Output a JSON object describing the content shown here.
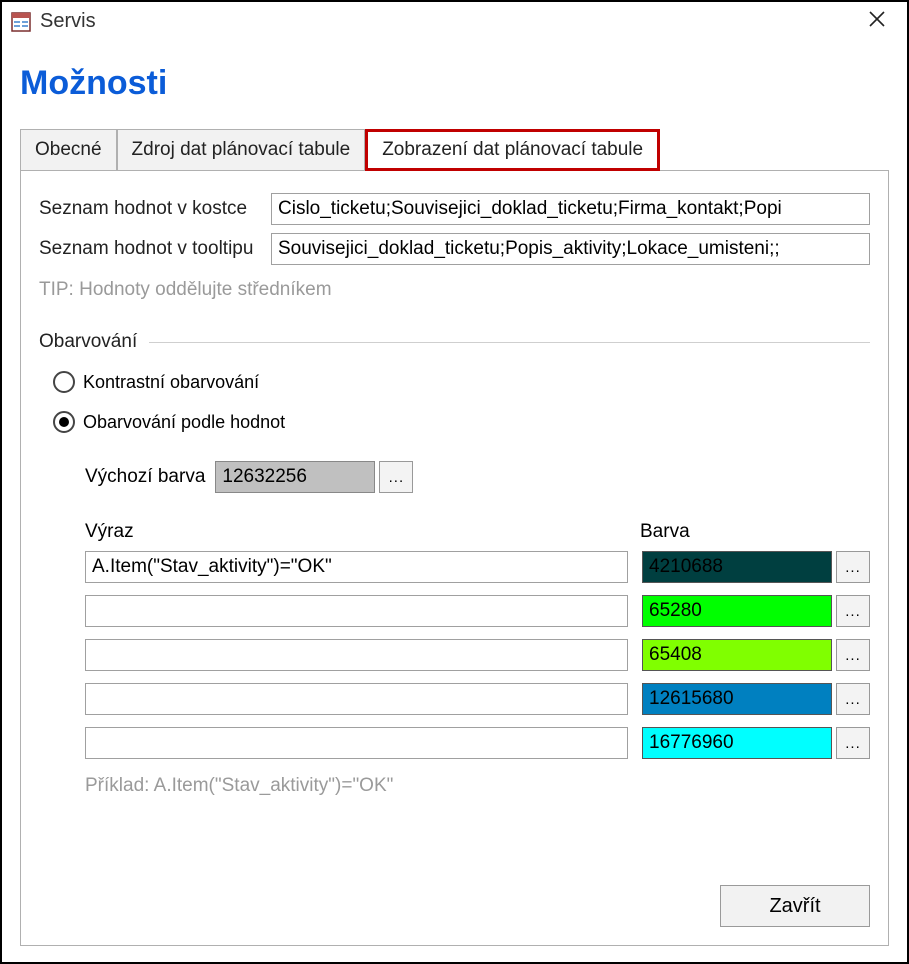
{
  "titlebar": {
    "title": "Servis"
  },
  "page_title": "Možnosti",
  "tabs": {
    "general": "Obecné",
    "data_source": "Zdroj dat plánovací tabule",
    "data_view": "Zobrazení dat plánovací tabule"
  },
  "fields": {
    "cube_label": "Seznam hodnot v kostce",
    "cube_value": "Cislo_ticketu;Souvisejici_doklad_ticketu;Firma_kontakt;Popi",
    "tooltip_label": "Seznam hodnot v tooltipu",
    "tooltip_value": "Souvisejici_doklad_ticketu;Popis_aktivity;Lokace_umisteni;;",
    "tip": "TIP: Hodnoty oddělujte středníkem"
  },
  "coloring": {
    "group_label": "Obarvování",
    "radio_contrast": "Kontrastní obarvování",
    "radio_by_values": "Obarvování podle hodnot",
    "default_color_label": "Výchozí barva",
    "default_color_value": "12632256",
    "default_color_hex": "#c0c0c0",
    "col_expr": "Výraz",
    "col_color": "Barva",
    "rows": [
      {
        "expr": "A.Item(\"Stav_aktivity\")=\"OK\"",
        "value": "4210688",
        "hex": "#003f40"
      },
      {
        "expr": "",
        "value": "65280",
        "hex": "#00ff00"
      },
      {
        "expr": "",
        "value": "65408",
        "hex": "#80ff00"
      },
      {
        "expr": "",
        "value": "12615680",
        "hex": "#0080c0"
      },
      {
        "expr": "",
        "value": "16776960",
        "hex": "#00ffff"
      }
    ],
    "example": "Příklad: A.Item(\"Stav_aktivity\")=\"OK\""
  },
  "buttons": {
    "ellipsis": "...",
    "close": "Zavřít"
  }
}
